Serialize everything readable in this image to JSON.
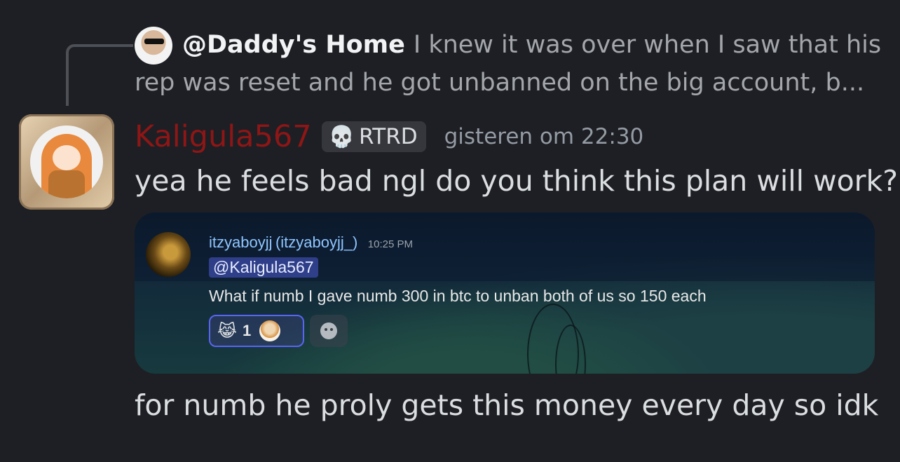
{
  "reply": {
    "author": "@Daddy's Home",
    "snippet_line1": "I knew it was over when I saw that his",
    "snippet_line2": "rep was reset and he got unbanned on the big account, b..."
  },
  "message": {
    "username": "Kaligula567",
    "username_color": "#8e1616",
    "role_tag": "RTRD",
    "role_icon": "skull-icon",
    "timestamp": "gisteren om 22:30",
    "text": "yea he feels bad ngl do you think this plan will work?",
    "followup_text": "for numb he proly gets this money every day so idk"
  },
  "embed": {
    "username": "itzyaboyjj",
    "handle": "(itzyaboyjj_)",
    "time": "10:25 PM",
    "mention": "@Kaligula567",
    "body": "What if numb I gave numb 300 in btc to unban both of us so 150 each",
    "reaction": {
      "emoji": "😹",
      "count": "1"
    },
    "add_reaction_icon": "smiley-icon"
  }
}
